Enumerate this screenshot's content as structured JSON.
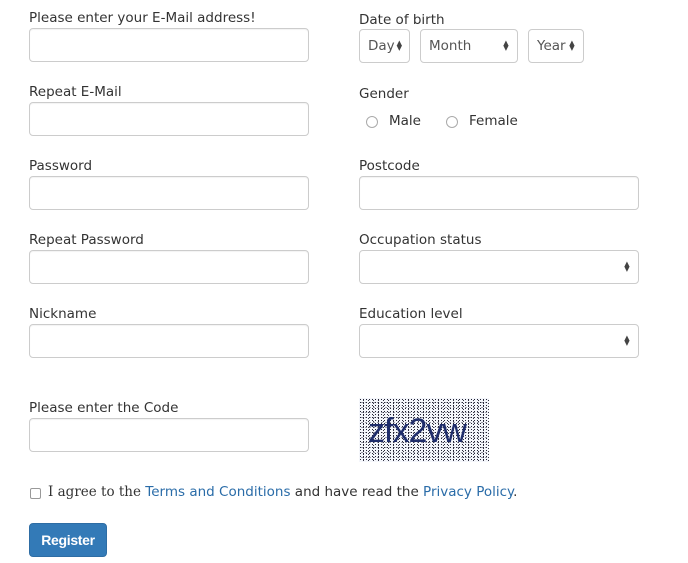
{
  "form": {
    "email": {
      "label": "Please enter your E-Mail address!",
      "value": "",
      "placeholder": ""
    },
    "repeat_email": {
      "label": "Repeat E-Mail",
      "value": "",
      "placeholder": ""
    },
    "password": {
      "label": "Password",
      "value": "",
      "placeholder": ""
    },
    "repeat_password": {
      "label": "Repeat Password",
      "value": "",
      "placeholder": ""
    },
    "nickname": {
      "label": "Nickname",
      "value": "",
      "placeholder": ""
    },
    "date_of_birth": {
      "label": "Date of birth",
      "day": "Day",
      "month": "Month",
      "year": "Year"
    },
    "gender": {
      "label": "Gender",
      "options": [
        "Male",
        "Female"
      ],
      "selected": null
    },
    "postcode": {
      "label": "Postcode",
      "value": ""
    },
    "occupation_status": {
      "label": "Occupation status",
      "selected": ""
    },
    "education_level": {
      "label": "Education level",
      "selected": ""
    },
    "code": {
      "label": "Please enter the Code",
      "value": ""
    },
    "captcha_text": "zfx2vw",
    "agree": {
      "checked": false,
      "prefix": "I agree to the ",
      "terms_link": "Terms and Conditions",
      "middle": " and have read the ",
      "privacy_link": "Privacy Policy",
      "suffix": "."
    },
    "register_button": "Register"
  },
  "colors": {
    "link": "#2a6ca8",
    "button": "#337ab7",
    "captcha_text": "#1f2d6b"
  }
}
